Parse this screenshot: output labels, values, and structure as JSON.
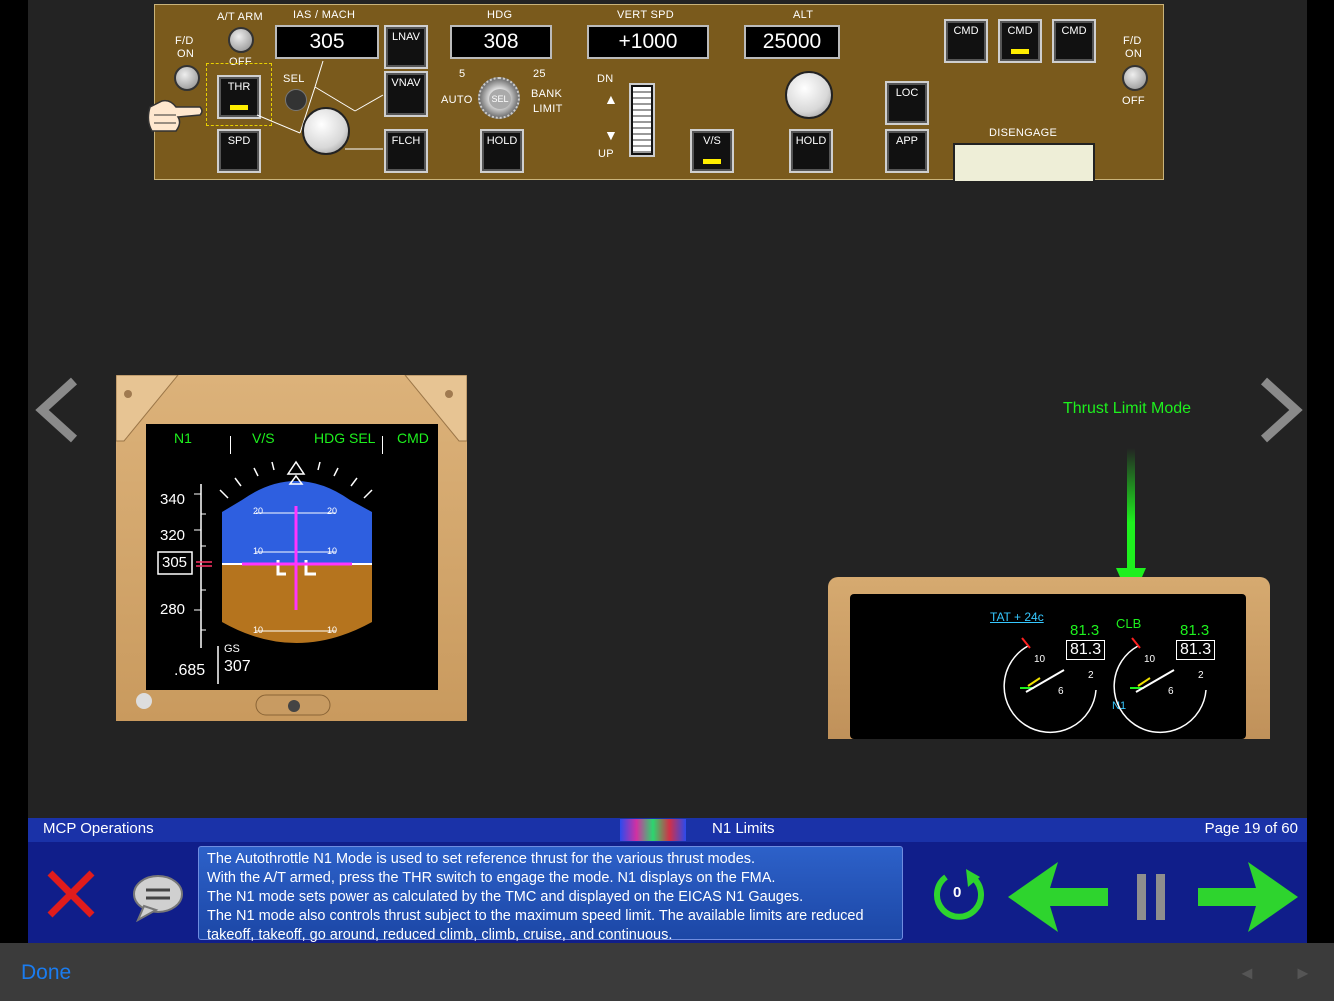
{
  "mcp": {
    "fd_left": {
      "top": "F/D",
      "on": "ON",
      "off": "OFF"
    },
    "at_arm": {
      "label": "A/T ARM",
      "off": "OFF"
    },
    "ias_label": "IAS / MACH",
    "ias_value": "305",
    "thr": "THR",
    "spd": "SPD",
    "sel": "SEL",
    "lnav": "LNAV",
    "vnav": "VNAV",
    "flch": "FLCH",
    "hdg_label": "HDG",
    "hdg_value": "308",
    "bank": {
      "min": "5",
      "max": "25",
      "auto": "AUTO",
      "limit_1": "BANK",
      "limit_2": "LIMIT",
      "sel": "SEL"
    },
    "hdg_hold": "HOLD",
    "vs_label": "VERT SPD",
    "vs_value": "+1000",
    "dn": "DN",
    "up": "UP",
    "vs_btn": "V/S",
    "alt_label": "ALT",
    "alt_value": "25000",
    "alt_hold": "HOLD",
    "loc": "LOC",
    "app": "APP",
    "cmd": [
      "CMD",
      "CMD",
      "CMD"
    ],
    "disengage": "DISENGAGE",
    "fd_right": {
      "top": "F/D",
      "on": "ON",
      "off": "OFF"
    }
  },
  "pfd": {
    "fma": [
      "N1",
      "V/S",
      "HDG SEL",
      "CMD"
    ],
    "speed_ticks": [
      "340",
      "320",
      "280"
    ],
    "speed_current": "305",
    "mach": ".685",
    "gs_label": "GS",
    "gs_value": "307",
    "pitch": [
      "20",
      "20",
      "10",
      "10",
      "10",
      "10"
    ]
  },
  "eicas": {
    "tat": "TAT + 24c",
    "mode": "CLB",
    "n1_left_target": "81.3",
    "n1_left": "81.3",
    "n1_right_target": "81.3",
    "n1_right": "81.3",
    "n1_label": "N1",
    "ticks": [
      "10",
      "6",
      "2",
      "10",
      "6",
      "2"
    ]
  },
  "callout": "Thrust Limit Mode",
  "lesson": {
    "section": "MCP Operations",
    "title": "N1 Limits",
    "page": "Page 19 of 60",
    "lines": [
      "The Autothrottle N1 Mode is used to set reference thrust for the various thrust modes.",
      "With the A/T armed, press the THR switch to engage the mode.  N1 displays on the FMA.",
      "The N1 mode sets power as calculated by the TMC and displayed on the EICAS N1 Gauges.",
      "The N1 mode also controls thrust subject to the maximum speed limit.  The available limits are reduced",
      "takeoff, takeoff, go around, reduced climb, climb, cruise, and continuous."
    ],
    "replay_count": "0"
  },
  "footer": {
    "done": "Done"
  },
  "colors": {
    "green": "#1ef01e",
    "brand_blue": "#101e8a",
    "mcp_brown": "#7a5a1c",
    "link_blue": "#1a7cf0"
  }
}
